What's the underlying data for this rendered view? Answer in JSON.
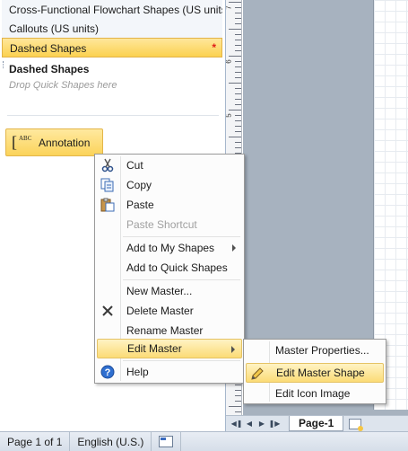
{
  "shapes_pane": {
    "stencils": [
      {
        "label": "Cross-Functional Flowchart Shapes (US units)"
      },
      {
        "label": "Callouts (US units)"
      },
      {
        "label": "Dashed Shapes",
        "marker": "*"
      }
    ],
    "quick_section": {
      "title": "Dashed Shapes",
      "hint": "Drop Quick Shapes here"
    },
    "master": {
      "label": "Annotation",
      "icon_text": "ABC"
    }
  },
  "context_menu": {
    "items": [
      {
        "label": "Cut",
        "icon": "scissors-icon"
      },
      {
        "label": "Copy",
        "icon": "copy-icon"
      },
      {
        "label": "Paste",
        "icon": "paste-icon"
      },
      {
        "label": "Paste Shortcut",
        "disabled": true
      },
      {
        "label": "Add to My Shapes",
        "submenu": true
      },
      {
        "label": "Add to Quick Shapes"
      },
      {
        "label": "New Master..."
      },
      {
        "label": "Delete Master",
        "icon": "delete-x-icon"
      },
      {
        "label": "Rename Master"
      },
      {
        "label": "Edit Master",
        "submenu": true,
        "highlighted": true
      },
      {
        "label": "Help",
        "icon": "help-icon"
      }
    ]
  },
  "submenu": {
    "items": [
      {
        "label": "Master Properties..."
      },
      {
        "label": "Edit Master Shape",
        "highlighted": true,
        "icon": "pencil-icon"
      },
      {
        "label": "Edit Icon Image"
      }
    ]
  },
  "page_tabs": {
    "current_page": "Page-1"
  },
  "status_bar": {
    "page_info": "Page 1 of 1",
    "language": "English (U.S.)"
  },
  "ruler": {
    "labels": [
      "7",
      "6",
      "5"
    ]
  },
  "colors": {
    "highlight": "#fbd150",
    "canvas": "#a7b2bf",
    "menu_border": "#9a9a9a"
  }
}
